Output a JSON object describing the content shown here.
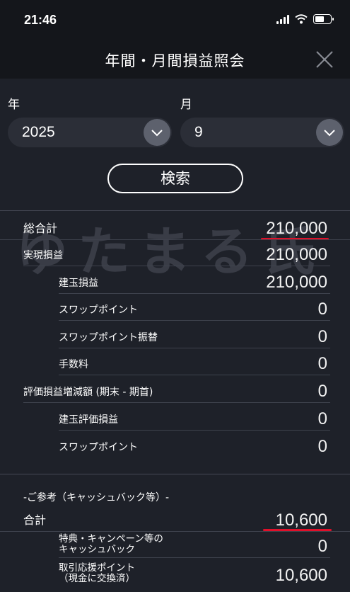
{
  "status_bar": {
    "time": "21:46"
  },
  "nav": {
    "title": "年間・月間損益照会"
  },
  "filters": {
    "year_label": "年",
    "year_value": "2025",
    "month_label": "月",
    "month_value": "9",
    "search_label": "検索"
  },
  "watermark": "ゆたまる氏",
  "totals": {
    "grand_total_label": "総合計",
    "grand_total_value": "210,000",
    "realized_label": "実現損益",
    "realized_value": "210,000",
    "position_pl_label": "建玉損益",
    "position_pl_value": "210,000",
    "swap_label": "スワップポイント",
    "swap_value": "0",
    "swap_transfer_label": "スワップポイント振替",
    "swap_transfer_value": "0",
    "fee_label": "手数料",
    "fee_value": "0",
    "unrealized_change_label": "評価損益増減額 (期末 - 期首)",
    "unrealized_change_value": "0",
    "position_eval_label": "建玉評価損益",
    "position_eval_value": "0",
    "swap2_label": "スワップポイント",
    "swap2_value": "0"
  },
  "reference": {
    "section_label": "-ご参考（キャッシュバック等）-",
    "total_label": "合計",
    "total_value": "10,600",
    "cashback_label_1": "特典・キャンペーン等の",
    "cashback_label_2": "キャッシュバック",
    "cashback_value": "0",
    "points_label_1": "取引応援ポイント",
    "points_label_2": "（現金に交換済）",
    "points_value": "10,600"
  },
  "colors": {
    "background": "#1e2129",
    "header": "#14161b",
    "highlight": "#e0102a"
  }
}
